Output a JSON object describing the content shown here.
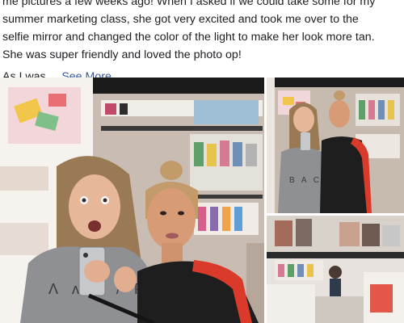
{
  "post": {
    "text_line_1": "me pictures a few weeks ago! When I asked if we could take some for my",
    "text_line_2": "summer marketing class, she got very excited and took me over to the",
    "text_line_3": "selfie mirror and changed the color of the light to make her look more tan.",
    "text_line_4": "She was super friendly and loved the photo op!",
    "truncated_text": "As I was ... ",
    "see_more_label": "See More",
    "see_more_color": "#385898"
  },
  "gallery": {
    "photo_count": 3,
    "photo_main_text": "Ʌ ʌ Ʌ / R V O",
    "photo_top_right_text": "B A C",
    "photos": [
      {
        "name": "mirror selfie with store employee",
        "layout": "large-left"
      },
      {
        "name": "second mirror selfie",
        "layout": "top-right"
      },
      {
        "name": "cosmetics store interior",
        "layout": "bottom-right"
      }
    ]
  }
}
